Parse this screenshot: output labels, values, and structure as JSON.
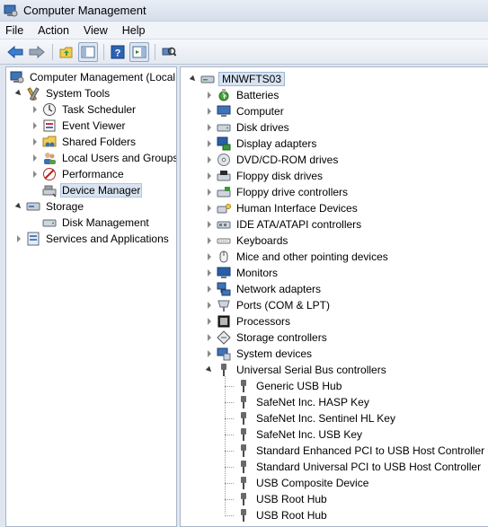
{
  "window": {
    "title": "Computer Management"
  },
  "menu": [
    "File",
    "Action",
    "View",
    "Help"
  ],
  "toolbar": {
    "buttons": [
      "back-arrow-icon",
      "forward-arrow-icon",
      "up-folder-icon",
      "show-hide-tree-icon",
      "help-icon",
      "action-pane-icon",
      "scan-hardware-icon"
    ]
  },
  "left_tree": [
    {
      "label": "Computer Management (Local",
      "icon": "computer-management-icon",
      "depth": 0,
      "expander": "none"
    },
    {
      "label": "System Tools",
      "icon": "tools-icon",
      "depth": 1,
      "expander": "open"
    },
    {
      "label": "Task Scheduler",
      "icon": "clock-icon",
      "depth": 2,
      "expander": "closed"
    },
    {
      "label": "Event Viewer",
      "icon": "event-viewer-icon",
      "depth": 2,
      "expander": "closed"
    },
    {
      "label": "Shared Folders",
      "icon": "shared-folder-icon",
      "depth": 2,
      "expander": "closed"
    },
    {
      "label": "Local Users and Groups",
      "icon": "users-icon",
      "depth": 2,
      "expander": "closed"
    },
    {
      "label": "Performance",
      "icon": "performance-icon",
      "depth": 2,
      "expander": "closed"
    },
    {
      "label": "Device Manager",
      "icon": "device-manager-icon",
      "depth": 2,
      "expander": "none",
      "selected": true
    },
    {
      "label": "Storage",
      "icon": "storage-icon",
      "depth": 1,
      "expander": "open"
    },
    {
      "label": "Disk Management",
      "icon": "disk-management-icon",
      "depth": 2,
      "expander": "none"
    },
    {
      "label": "Services and Applications",
      "icon": "services-icon",
      "depth": 1,
      "expander": "closed"
    }
  ],
  "device_tree": {
    "root": {
      "label": "MNWFTS03",
      "icon": "computer-icon"
    },
    "categories": [
      {
        "label": "Batteries",
        "icon": "battery-icon"
      },
      {
        "label": "Computer",
        "icon": "computer-icon"
      },
      {
        "label": "Disk drives",
        "icon": "disk-drive-icon"
      },
      {
        "label": "Display adapters",
        "icon": "display-adapter-icon"
      },
      {
        "label": "DVD/CD-ROM drives",
        "icon": "dvd-drive-icon"
      },
      {
        "label": "Floppy disk drives",
        "icon": "floppy-drive-icon"
      },
      {
        "label": "Floppy drive controllers",
        "icon": "floppy-controller-icon"
      },
      {
        "label": "Human Interface Devices",
        "icon": "hid-icon"
      },
      {
        "label": "IDE ATA/ATAPI controllers",
        "icon": "ide-controller-icon"
      },
      {
        "label": "Keyboards",
        "icon": "keyboard-icon"
      },
      {
        "label": "Mice and other pointing devices",
        "icon": "mouse-icon"
      },
      {
        "label": "Monitors",
        "icon": "monitor-icon"
      },
      {
        "label": "Network adapters",
        "icon": "network-adapter-icon"
      },
      {
        "label": "Ports (COM & LPT)",
        "icon": "port-icon"
      },
      {
        "label": "Processors",
        "icon": "processor-icon"
      },
      {
        "label": "Storage controllers",
        "icon": "storage-controller-icon"
      },
      {
        "label": "System devices",
        "icon": "system-device-icon"
      },
      {
        "label": "Universal Serial Bus controllers",
        "icon": "usb-icon",
        "expanded": true
      }
    ],
    "usb_children": [
      "Generic USB Hub",
      "SafeNet Inc. HASP Key",
      "SafeNet Inc. Sentinel HL Key",
      "SafeNet Inc. USB Key",
      "Standard Enhanced PCI to USB Host Controller",
      "Standard Universal PCI to USB Host Controller",
      "USB Composite Device",
      "USB Root Hub",
      "USB Root Hub"
    ]
  }
}
